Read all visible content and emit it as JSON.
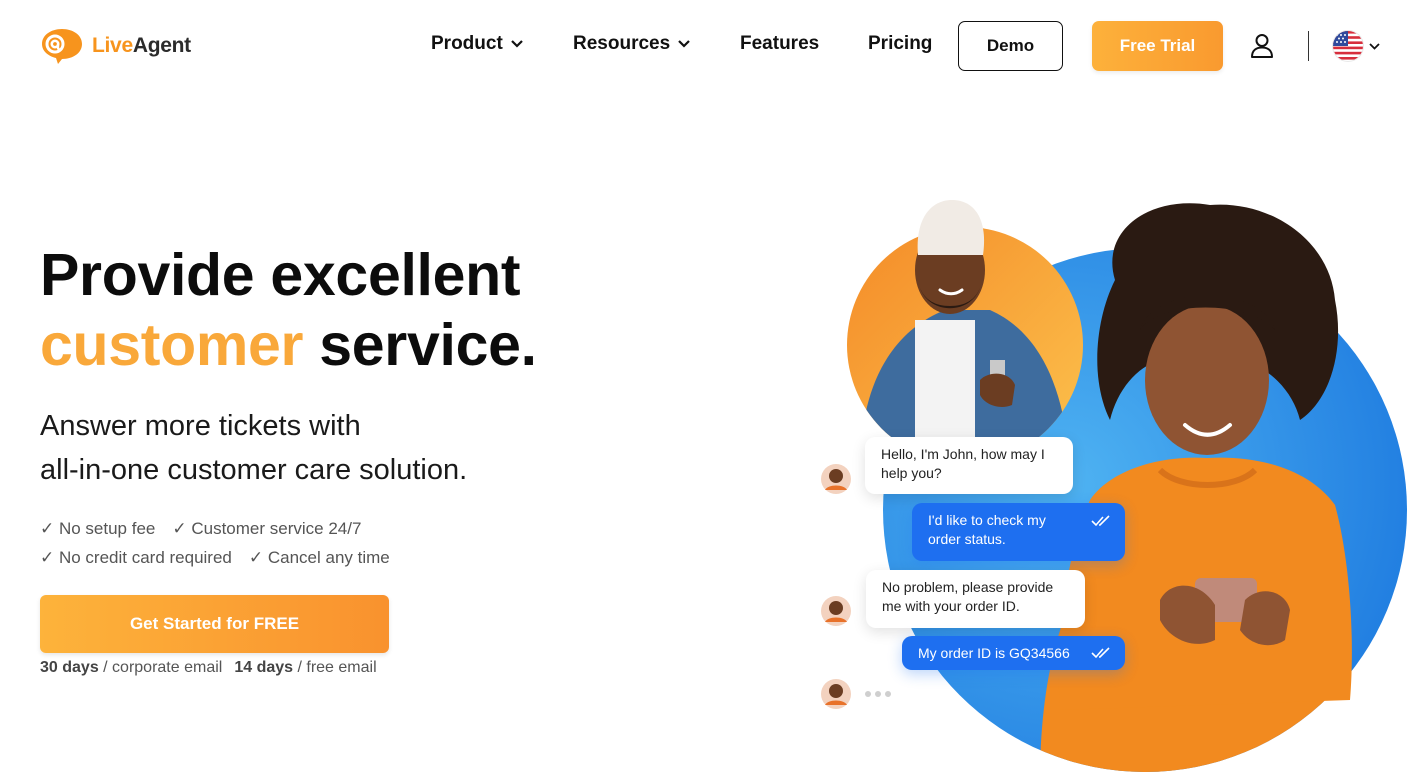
{
  "header": {
    "logo": {
      "live": "Live",
      "agent": "Agent"
    },
    "nav": [
      {
        "label": "Product",
        "has_dropdown": true
      },
      {
        "label": "Resources",
        "has_dropdown": true
      },
      {
        "label": "Features",
        "has_dropdown": false
      },
      {
        "label": "Pricing",
        "has_dropdown": false
      }
    ],
    "demo_label": "Demo",
    "trial_label": "Free Trial",
    "user_icon": "user-icon",
    "language_icon": "us-flag-icon"
  },
  "hero": {
    "title_line1": "Provide excellent",
    "title_accent": "customer",
    "title_rest": "service.",
    "subtitle_line1": "Answer more tickets with",
    "subtitle_line2": "all-in-one customer care solution.",
    "checks": [
      "✓ No setup fee",
      "✓ Customer service 24/7",
      "✓ No credit card required",
      "✓ Cancel any time"
    ],
    "cta_label": "Get Started for FREE",
    "note": {
      "days1": "30 days",
      "text1": " / corporate email",
      "days2": "14 days",
      "text2": " / free email"
    }
  },
  "chat": {
    "messages": [
      {
        "from": "agent",
        "text_line1": "Hello, I'm John, how may I",
        "text_line2": "help you?"
      },
      {
        "from": "customer",
        "text_line1": "I'd like to check my",
        "text_line2": "order status."
      },
      {
        "from": "agent",
        "text_line1": "No problem, please provide",
        "text_line2": "me with your order ID."
      },
      {
        "from": "customer",
        "text_line1": "My order ID is GQ34566",
        "text_line2": ""
      }
    ]
  },
  "colors": {
    "brand_orange": "#f9a83a",
    "chat_blue": "#1e6ff0",
    "circle_blue": "#2d8ce8"
  }
}
